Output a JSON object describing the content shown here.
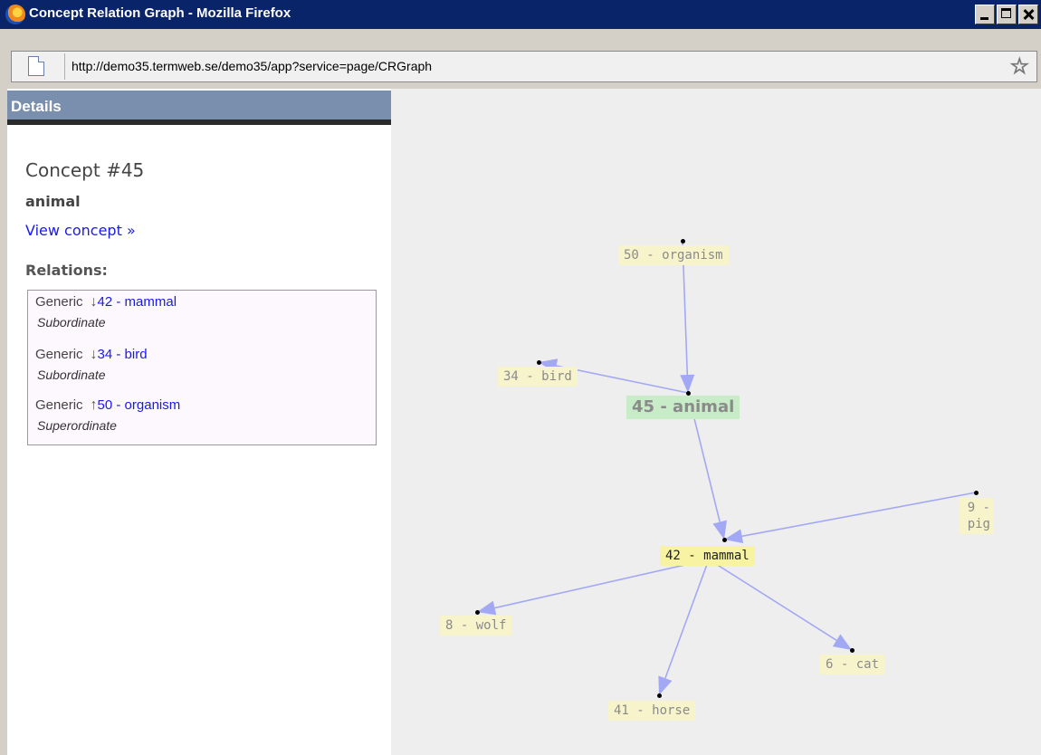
{
  "window": {
    "title": "Concept Relation Graph - Mozilla Firefox",
    "url": "http://demo35.termweb.se/demo35/app?service=page/CRGraph"
  },
  "details": {
    "header": "Details",
    "concept_title": "Concept #45",
    "concept_name": "animal",
    "view_link": "View concept »",
    "relations_label": "Relations:",
    "relations": [
      {
        "kind": "Generic",
        "direction": "↓",
        "target": "42 - mammal",
        "type": "Subordinate"
      },
      {
        "kind": "Generic",
        "direction": "↓",
        "target": "34 - bird",
        "type": "Subordinate"
      },
      {
        "kind": "Generic",
        "direction": "↑",
        "target": "50 - organism",
        "type": "Superordinate"
      }
    ]
  },
  "graph": {
    "nodes": {
      "organism": "50 - organism",
      "bird": "34 - bird",
      "animal": "45 - animal",
      "pig": "9 - pig",
      "mammal": "42 - mammal",
      "wolf": "8 - wolf",
      "cat": "6 - cat",
      "horse": "41 - horse"
    },
    "edges": [
      [
        "organism",
        "animal"
      ],
      [
        "animal",
        "bird"
      ],
      [
        "animal",
        "mammal"
      ],
      [
        "pig",
        "mammal"
      ],
      [
        "mammal",
        "wolf"
      ],
      [
        "mammal",
        "horse"
      ],
      [
        "mammal",
        "cat"
      ]
    ],
    "colors": {
      "edge": "#a3a8f5",
      "center": "#c8ecc8",
      "focus": "#f7f3a3",
      "node": "#f7f4cc"
    }
  }
}
